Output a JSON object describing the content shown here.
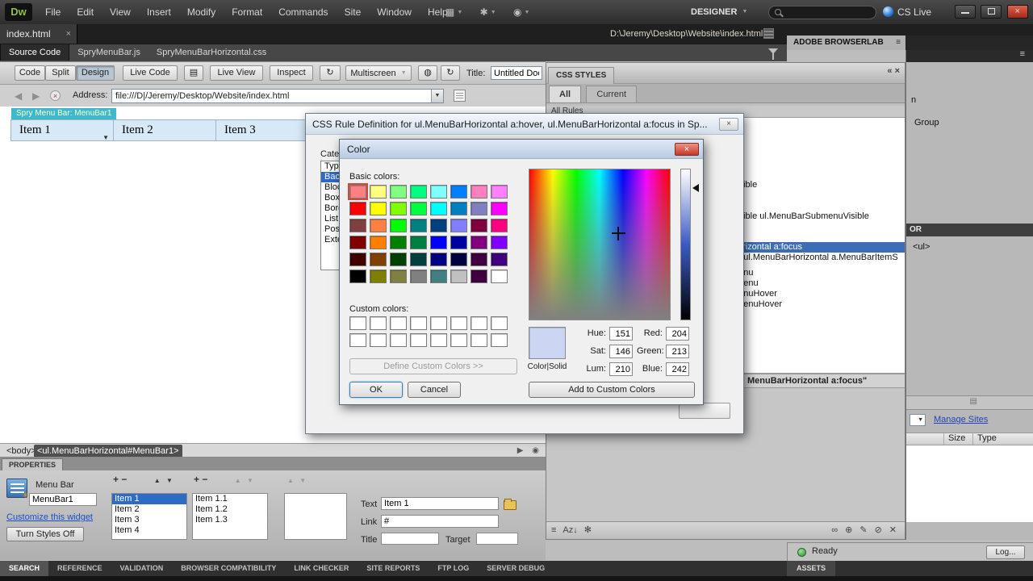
{
  "ui_colors": {
    "selection_blue": "#316ac5",
    "tree_selection": "#3e6db5",
    "preview": "#ccd5f2",
    "slider_mid": "#3b5bc4",
    "widget_label_bg": "#3db8cc",
    "menu_cell_bg": "#d7e9f7",
    "close_red": "#c23b2a"
  },
  "icons": {
    "close": "×",
    "dropdown": "▼",
    "up": "▲",
    "back": "◀",
    "forward": "▶",
    "stop": "×",
    "menu": "≡",
    "collapse": "«",
    "grid": "▦",
    "gear": "✱",
    "users": "◉",
    "cursor": "▶",
    "hand": "◉",
    "plus": "+",
    "minus": "−",
    "panel_left_icons": [
      "≡",
      "Az↓",
      "✻"
    ],
    "panel_right_icons": [
      "∞",
      "⊕",
      "✎",
      "⊘",
      "✕"
    ]
  },
  "menubar": {
    "logo": "Dw",
    "items": [
      "File",
      "Edit",
      "View",
      "Insert",
      "Modify",
      "Format",
      "Commands",
      "Site",
      "Window",
      "Help"
    ],
    "workspace": "DESIGNER",
    "cs_live": "CS Live"
  },
  "doc_tab": {
    "label": "index.html",
    "path": "D:\\Jeremy\\Desktop\\Website\\index.html"
  },
  "related_files": [
    "Source Code",
    "SpryMenuBar.js",
    "SpryMenuBarHorizontal.css"
  ],
  "toolbar": {
    "code": "Code",
    "split": "Split",
    "design": "Design",
    "live_code": "Live Code",
    "live_view": "Live View",
    "inspect": "Inspect",
    "multiscreen": "Multiscreen",
    "title_label": "Title:",
    "title_value": "Untitled Docu"
  },
  "address": {
    "label": "Address:",
    "value": "file:///D|/Jeremy/Desktop/Website/index.html"
  },
  "document": {
    "widget_label": "Spry Menu Bar: MenuBar1",
    "menu_items": [
      "Item 1",
      "Item 2",
      "Item 3"
    ]
  },
  "browserlab": {
    "title": "ADOBE BROWSERLAB"
  },
  "css_panel": {
    "title": "CSS STYLES",
    "tabs": [
      "All",
      "Current"
    ],
    "all_rules": "All Rules",
    "tree": [
      {
        "text": "Visible",
        "selected": false
      },
      {
        "text": "Visible ul.MenuBarSubmenuVisible",
        "selected": false
      },
      {
        "text": "Horizontal a:focus",
        "selected": true
      },
      {
        "text": "er, ul.MenuBarHorizontal a.MenuBarItemS",
        "selected": false
      },
      {
        "text": "menu",
        "selected": false
      },
      {
        "text": "bmenu",
        "selected": false
      },
      {
        "text": "menuHover",
        "selected": false
      },
      {
        "text": "bmenuHover",
        "selected": false
      }
    ],
    "properties_header": "MenuBarHorizontal a:focus\""
  },
  "right_strip": {
    "fragments": [
      "n",
      "Group"
    ],
    "inspector_header": "OR",
    "tag": "<ul>",
    "manage_sites": "Manage Sites",
    "columns": [
      "Size",
      "Type"
    ]
  },
  "rule_dialog": {
    "title": "CSS Rule Definition for ul.MenuBarHorizontal a:hover, ul.MenuBarHorizontal a:focus in Sp...",
    "category_label": "Cate",
    "categories": [
      "Type",
      "Back",
      "Block",
      "Box",
      "Bord",
      "List",
      "Positi",
      "Exte"
    ],
    "selected_category": "Back"
  },
  "color_dialog": {
    "title": "Color",
    "basic_label": "Basic colors:",
    "custom_label": "Custom colors:",
    "basic_colors": [
      "#FF8080",
      "#FFFF80",
      "#80FF80",
      "#00FF80",
      "#80FFFF",
      "#0080FF",
      "#FF80C0",
      "#FF80FF",
      "#FF0000",
      "#FFFF00",
      "#80FF00",
      "#00FF40",
      "#00FFFF",
      "#0080C0",
      "#8080C0",
      "#FF00FF",
      "#804040",
      "#FF8040",
      "#00FF00",
      "#008080",
      "#004080",
      "#8080FF",
      "#800040",
      "#FF0080",
      "#800000",
      "#FF8000",
      "#008000",
      "#008040",
      "#0000FF",
      "#0000A0",
      "#800080",
      "#8000FF",
      "#400000",
      "#804000",
      "#004000",
      "#004040",
      "#000080",
      "#000040",
      "#400040",
      "#400080",
      "#000000",
      "#808000",
      "#808040",
      "#808080",
      "#408080",
      "#C0C0C0",
      "#400040",
      "#FFFFFF"
    ],
    "custom_colors": [
      "#FFFFFF",
      "#FFFFFF",
      "#FFFFFF",
      "#FFFFFF",
      "#FFFFFF",
      "#FFFFFF",
      "#FFFFFF",
      "#FFFFFF",
      "#FFFFFF",
      "#FFFFFF",
      "#FFFFFF",
      "#FFFFFF",
      "#FFFFFF",
      "#FFFFFF",
      "#FFFFFF",
      "#FFFFFF"
    ],
    "define_custom": "Define Custom Colors >>",
    "ok": "OK",
    "cancel": "Cancel",
    "add_custom": "Add to Custom Colors",
    "preview_label": "Color|Solid",
    "fields": [
      {
        "label": "Hue:",
        "value": "151"
      },
      {
        "label": "Sat:",
        "value": "146"
      },
      {
        "label": "Lum:",
        "value": "210"
      },
      {
        "label": "Red:",
        "value": "204"
      },
      {
        "label": "Green:",
        "value": "213"
      },
      {
        "label": "Blue:",
        "value": "242"
      }
    ],
    "preview_color": "#CCD5F2"
  },
  "tag_selector": [
    "<body>",
    "<ul.MenuBarHorizontal#MenuBar1>"
  ],
  "properties_panel": {
    "tab": "PROPERTIES",
    "widget_type": "Menu Bar",
    "widget_name": "MenuBar1",
    "customize": "Customize this widget",
    "turn_styles_off": "Turn Styles Off",
    "list1": [
      "Item 1",
      "Item 2",
      "Item 3",
      "Item 4"
    ],
    "list1_selected": 0,
    "list2": [
      "Item 1.1",
      "Item 1.2",
      "Item 1.3"
    ],
    "text_label": "Text",
    "text_value": "Item 1",
    "link_label": "Link",
    "link_value": "#",
    "title_label": "Title",
    "title_value": "",
    "target_label": "Target",
    "target_value": ""
  },
  "status": {
    "ready": "Ready",
    "log": "Log..."
  },
  "bottom_tabs": [
    "SEARCH",
    "REFERENCE",
    "VALIDATION",
    "BROWSER COMPATIBILITY",
    "LINK CHECKER",
    "SITE REPORTS",
    "FTP LOG",
    "SERVER DEBUG"
  ],
  "assets_tab": "ASSETS"
}
